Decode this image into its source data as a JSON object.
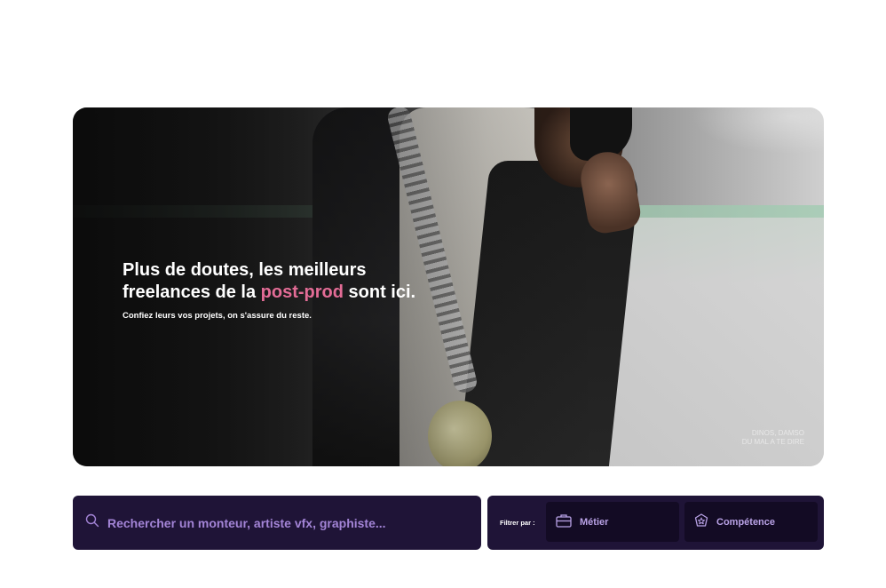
{
  "hero": {
    "title_line1": "Plus de doutes, les meilleurs",
    "title_line2_pre": "freelances de la ",
    "title_line2_accent": "post-prod",
    "title_line2_post": " sont ici.",
    "subtitle": "Confiez leurs vos projets, on s'assure du reste.",
    "credit_line1": "DINOS, DAMSO",
    "credit_line2": "DU MAL A TE DIRE",
    "accent_color": "#e36c96"
  },
  "search": {
    "placeholder": "Rechercher un monteur, artiste vfx, graphiste...",
    "icon": "search-icon"
  },
  "filters": {
    "label": "Filtrer par :",
    "metier_label": "Métier",
    "metier_icon": "briefcase-icon",
    "competence_label": "Compétence",
    "competence_icon": "star-badge-icon"
  },
  "colors": {
    "panel_bg": "#1f1437",
    "button_bg": "#130b24",
    "text_purple": "#a384d6"
  }
}
